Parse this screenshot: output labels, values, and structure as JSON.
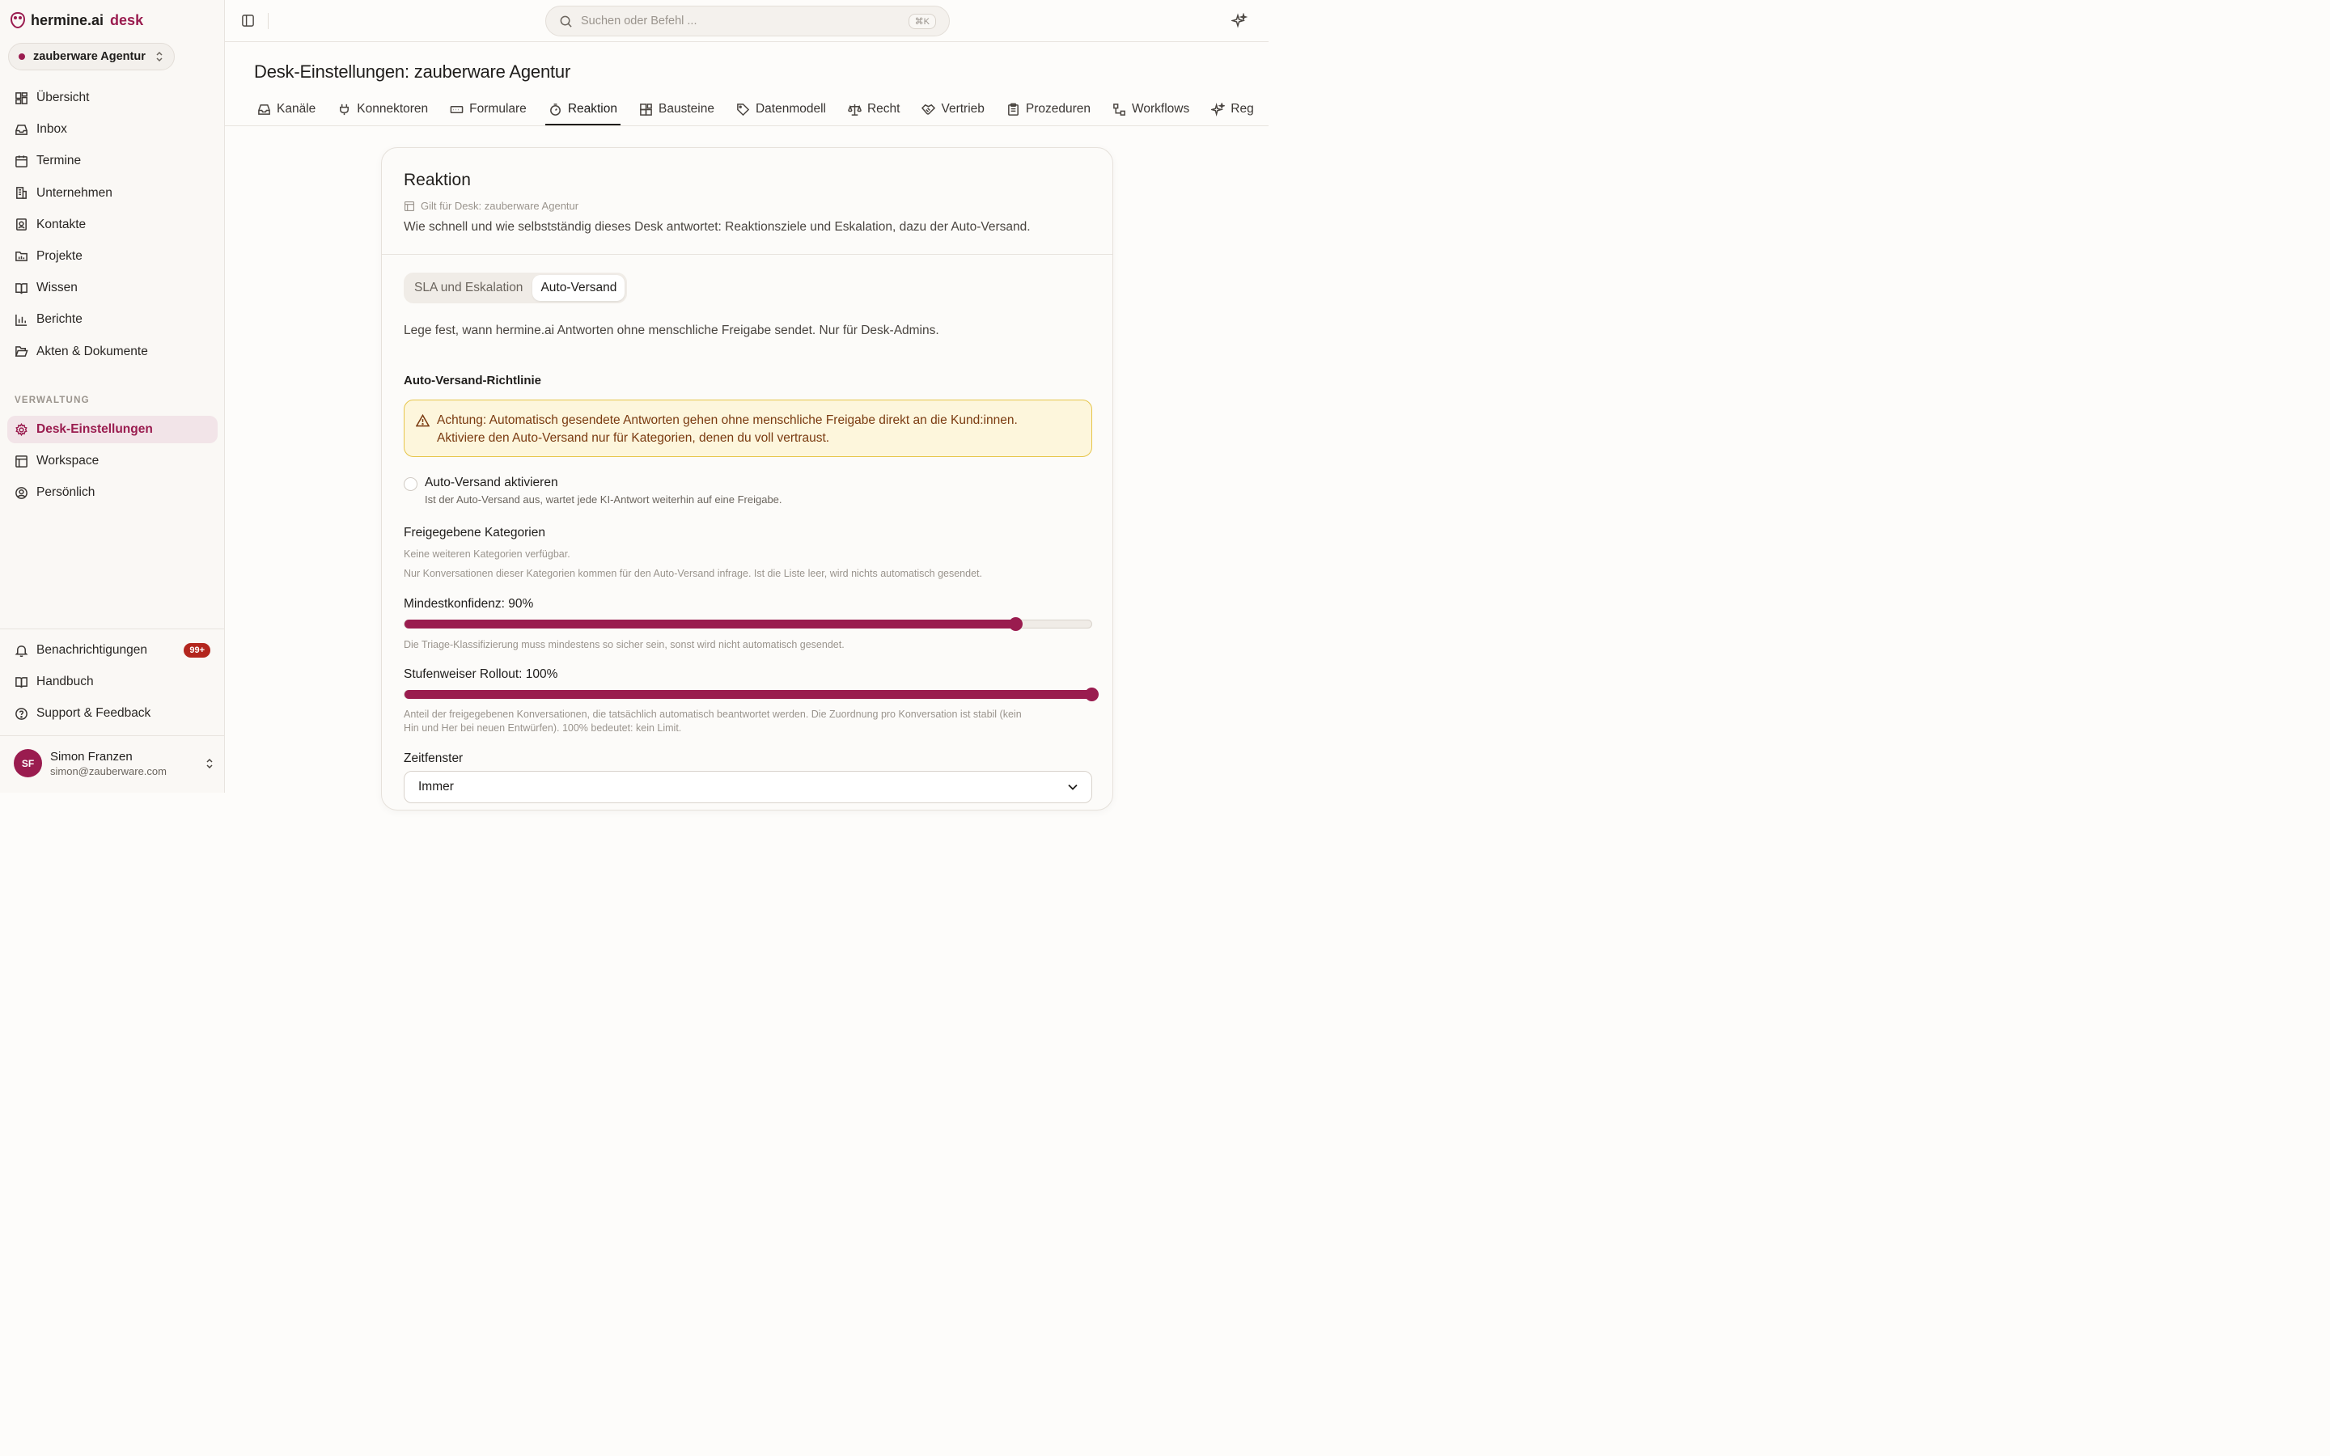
{
  "brand": {
    "name": "hermine.ai",
    "product": "desk"
  },
  "workspace": {
    "name": "zauberware Agentur"
  },
  "nav": {
    "items": [
      {
        "label": "Übersicht",
        "icon": "dashboard-icon"
      },
      {
        "label": "Inbox",
        "icon": "inbox-icon"
      },
      {
        "label": "Termine",
        "icon": "calendar-icon"
      },
      {
        "label": "Unternehmen",
        "icon": "building-icon"
      },
      {
        "label": "Kontakte",
        "icon": "contact-icon"
      },
      {
        "label": "Projekte",
        "icon": "folder-chart-icon"
      },
      {
        "label": "Wissen",
        "icon": "book-icon"
      },
      {
        "label": "Berichte",
        "icon": "bar-chart-icon"
      },
      {
        "label": "Akten & Dokumente",
        "icon": "folder-open-icon"
      }
    ],
    "section_label": "VERWALTUNG",
    "admin_items": [
      {
        "label": "Desk-Einstellungen",
        "icon": "gear-icon",
        "active": true
      },
      {
        "label": "Workspace",
        "icon": "layout-icon"
      },
      {
        "label": "Persönlich",
        "icon": "user-circle-icon"
      }
    ],
    "bottom_items": [
      {
        "label": "Benachrichtigungen",
        "icon": "bell-icon",
        "badge": "99+"
      },
      {
        "label": "Handbuch",
        "icon": "book-icon"
      },
      {
        "label": "Support & Feedback",
        "icon": "help-circle-icon"
      }
    ]
  },
  "user": {
    "initials": "SF",
    "name": "Simon Franzen",
    "email": "simon@zauberware.com"
  },
  "search": {
    "placeholder": "Suchen oder Befehl ...",
    "shortcut": "⌘K"
  },
  "page": {
    "title": "Desk-Einstellungen: zauberware Agentur",
    "tabs": [
      {
        "label": "Kanäle",
        "icon": "inbox-icon"
      },
      {
        "label": "Konnektoren",
        "icon": "plug-icon"
      },
      {
        "label": "Formulare",
        "icon": "form-icon"
      },
      {
        "label": "Reaktion",
        "icon": "timer-icon",
        "active": true
      },
      {
        "label": "Bausteine",
        "icon": "blocks-icon"
      },
      {
        "label": "Datenmodell",
        "icon": "tag-icon"
      },
      {
        "label": "Recht",
        "icon": "scale-icon"
      },
      {
        "label": "Vertrieb",
        "icon": "handshake-icon"
      },
      {
        "label": "Prozeduren",
        "icon": "clipboard-icon"
      },
      {
        "label": "Workflows",
        "icon": "workflow-icon"
      },
      {
        "label": "Reg",
        "icon": "sparkle-icon"
      }
    ]
  },
  "card": {
    "title": "Reaktion",
    "scope": "Gilt für Desk: zauberware Agentur",
    "description": "Wie schnell und wie selbstständig dieses Desk antwortet: Reaktionsziele und Eskalation, dazu der Auto-Versand.",
    "segments": [
      {
        "label": "SLA und Eskalation"
      },
      {
        "label": "Auto-Versand",
        "active": true
      }
    ],
    "intro": "Lege fest, wann hermine.ai Antworten ohne menschliche Freigabe sendet. Nur für Desk-Admins.",
    "policy_heading": "Auto-Versand-Richtlinie",
    "warning_line1": "Achtung: Automatisch gesendete Antworten gehen ohne menschliche Freigabe direkt an die Kund:innen.",
    "warning_line2": "Aktiviere den Auto-Versand nur für Kategorien, denen du voll vertraust.",
    "enable_label": "Auto-Versand aktivieren",
    "enable_help": "Ist der Auto-Versand aus, wartet jede KI-Antwort weiterhin auf eine Freigabe.",
    "enable_checked": false,
    "categories_heading": "Freigegebene Kategorien",
    "categories_empty": "Keine weiteren Kategorien verfügbar.",
    "categories_help": "Nur Konversationen dieser Kategorien kommen für den Auto-Versand infrage. Ist die Liste leer, wird nichts automatisch gesendet.",
    "confidence_label": "Mindestkonfidenz: 90%",
    "confidence_value": 90,
    "confidence_help": "Die Triage-Klassifizierung muss mindestens so sicher sein, sonst wird nicht automatisch gesendet.",
    "rollout_label": "Stufenweiser Rollout: 100%",
    "rollout_value": 100,
    "rollout_help_line1": "Anteil der freigegebenen Konversationen, die tatsächlich automatisch beantwortet werden. Die Zuordnung pro Konversation ist stabil (kein",
    "rollout_help_line2": "Hin und Her bei neuen Entwürfen). 100% bedeutet: kein Limit.",
    "time_heading": "Zeitfenster",
    "time_value": "Immer"
  },
  "colors": {
    "accent": "#9a1c4f",
    "warning_bg": "#fdf6dc",
    "warning_border": "#e6c54a",
    "badge": "#b3261e"
  }
}
